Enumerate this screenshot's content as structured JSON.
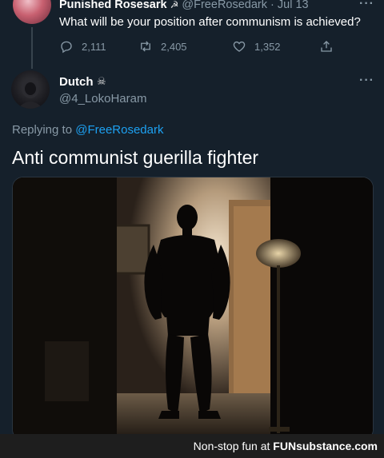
{
  "parent_tweet": {
    "display_name": "Punished Rosesark",
    "name_emoji": "☭",
    "handle": "@FreeRosedark",
    "date": "Jul 13",
    "separator": "·",
    "text": "What will be your position after communism is achieved?",
    "more_label": "···",
    "actions": {
      "replies": "2,111",
      "retweets": "2,405",
      "likes": "1,352"
    }
  },
  "reply_tweet": {
    "display_name": "Dutch",
    "name_emoji": "☠",
    "handle": "@4_LokoHaram",
    "more_label": "···",
    "replying_prefix": "Replying to",
    "replying_to": "@FreeRosedark",
    "text": "Anti communist guerilla fighter",
    "media_icon": "dark-room-silhouette-photo"
  },
  "watermark": {
    "prefix": "Non-stop fun at",
    "brand": "FUNsubstance.com"
  },
  "colors": {
    "background": "#15202b",
    "secondary_text": "#8899a6",
    "link": "#1da1f2",
    "footer": "#1e1e1e"
  }
}
